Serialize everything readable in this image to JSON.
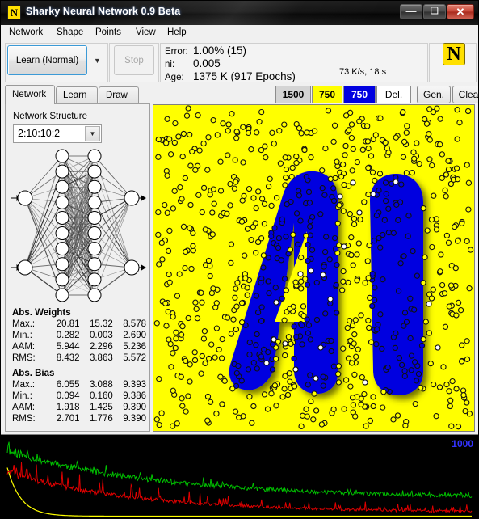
{
  "window": {
    "title": "Sharky Neural Network 0.9 Beta",
    "icon_letter": "N",
    "minimize_glyph": "—",
    "maximize_glyph": "❑",
    "close_glyph": "✕"
  },
  "menu": {
    "items": [
      {
        "label": "Network"
      },
      {
        "label": "Shape"
      },
      {
        "label": "Points"
      },
      {
        "label": "View"
      },
      {
        "label": "Help"
      }
    ]
  },
  "toolbar": {
    "learn_button": "Learn (Normal)",
    "learn_dropdown_glyph": "▼",
    "stop_button": "Stop",
    "stats": {
      "error_label": "Error:",
      "error_value": "1.00% (15)",
      "ni_label": "ni:",
      "ni_value": "0.005",
      "age_label": "Age:",
      "age_value": "1375 K (917 Epochs)"
    },
    "speed": "73 K/s, 18 s",
    "logo_letter": "N"
  },
  "tabs": [
    {
      "label": "Network",
      "active": true
    },
    {
      "label": "Learn",
      "active": false
    },
    {
      "label": "Draw",
      "active": false
    }
  ],
  "point_buttons": [
    {
      "label": "1500",
      "style": "gray"
    },
    {
      "label": "750",
      "style": "yellow"
    },
    {
      "label": "750",
      "style": "blue"
    },
    {
      "label": "Del.",
      "style": "white"
    },
    {
      "label": "Gen.",
      "style": "default"
    },
    {
      "label": "Clear",
      "style": "default"
    }
  ],
  "network_panel": {
    "structure_label": "Network Structure",
    "structure_value": "2:10:10:2",
    "dropdown_glyph": "▼",
    "layers": [
      2,
      10,
      10,
      2
    ],
    "weights": {
      "title": "Abs. Weights",
      "rows": [
        {
          "key": "Max.:",
          "c1": "20.81",
          "c2": "15.32",
          "c3": "8.578"
        },
        {
          "key": "Min.:",
          "c1": "0.282",
          "c2": "0.003",
          "c3": "2.690"
        },
        {
          "key": "AAM:",
          "c1": "5.944",
          "c2": "2.296",
          "c3": "5.236"
        },
        {
          "key": "RMS:",
          "c1": "8.432",
          "c2": "3.863",
          "c3": "5.572"
        }
      ]
    },
    "bias": {
      "title": "Abs. Bias",
      "rows": [
        {
          "key": "Max.:",
          "c1": "6.055",
          "c2": "3.088",
          "c3": "9.393"
        },
        {
          "key": "Min.:",
          "c1": "0.094",
          "c2": "0.160",
          "c3": "9.386"
        },
        {
          "key": "AAM:",
          "c1": "1.918",
          "c2": "1.425",
          "c3": "9.390"
        },
        {
          "key": "RMS:",
          "c1": "2.701",
          "c2": "1.776",
          "c3": "9.390"
        }
      ]
    }
  },
  "canvas": {
    "background_color": "#ffff00",
    "shape_color": "#0000e0",
    "shape_text": "AI",
    "point_count_visible": 1500
  },
  "graph": {
    "max_label": "1000",
    "background_color": "#000000",
    "series": [
      {
        "name": "green-error-trace",
        "color": "#00c000"
      },
      {
        "name": "red-error-trace",
        "color": "#e00000"
      },
      {
        "name": "yellow-decay-trace",
        "color": "#ffff00"
      }
    ]
  }
}
